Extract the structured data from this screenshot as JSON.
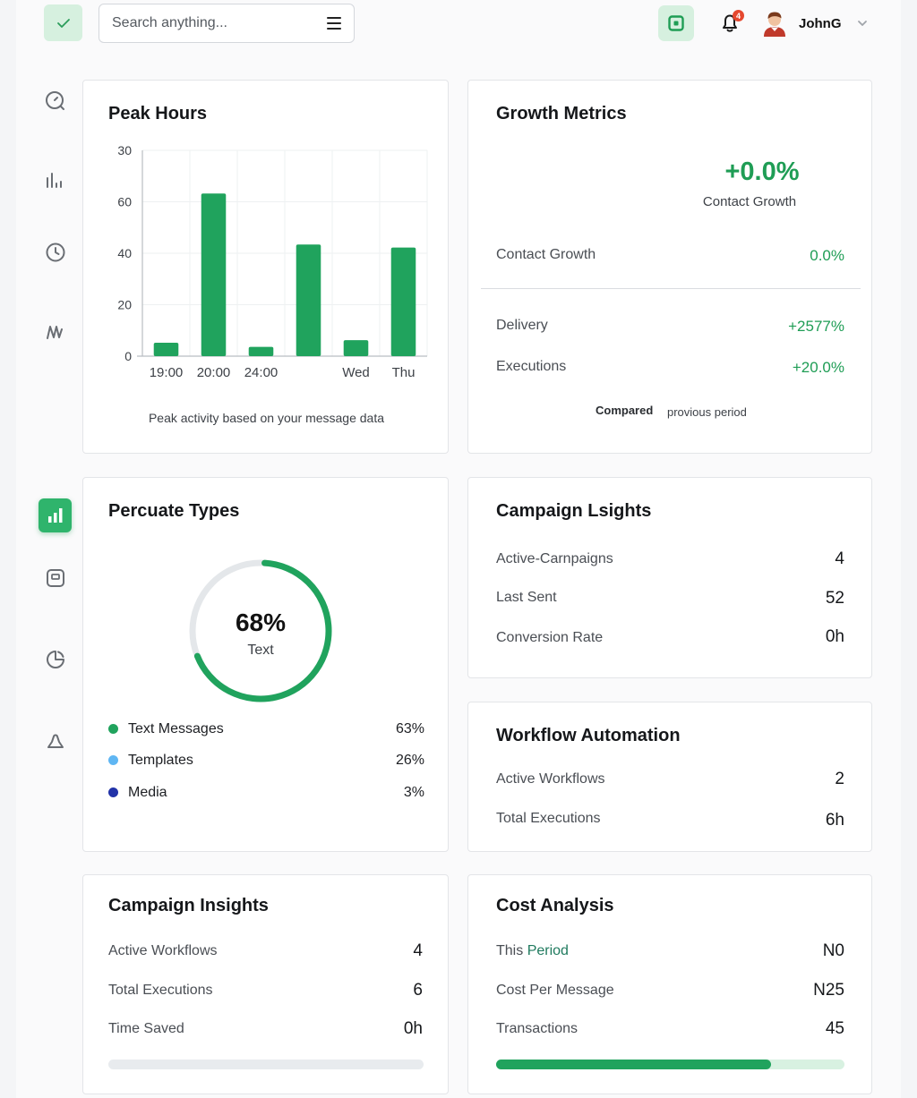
{
  "header": {
    "search_placeholder": "Search anything...",
    "notification_count": "4",
    "username": "JohnG"
  },
  "colors": {
    "accent": "#20a35d",
    "accent_light": "#d6f0df",
    "badge": "#e5482f",
    "templates": "#5fb6f3",
    "media": "#2233a8"
  },
  "peak_hours": {
    "title": "Peak Hours",
    "caption": "Peak activity based on your message data",
    "chart_data": {
      "type": "bar",
      "categories": [
        "19:00",
        "20:00",
        "24:00",
        "",
        "Wed",
        "Thu"
      ],
      "values": [
        2.6,
        31.6,
        1.8,
        21.7,
        3.1,
        21.1
      ],
      "y_ticks": [
        "0",
        "20",
        "40",
        "60",
        "30"
      ],
      "y_tick_values": [
        0,
        10,
        20,
        30,
        40
      ],
      "ylim": [
        0,
        40
      ]
    }
  },
  "growth": {
    "title": "Growth Metrics",
    "big_value": "+0.0%",
    "big_label": "Contact Growth",
    "rows": [
      {
        "label": "Contact Growth",
        "value": "0.0%"
      },
      {
        "label": "Delivery",
        "value": "+2577%"
      },
      {
        "label": "Executions",
        "value": "+20.0%"
      }
    ],
    "footer_bold": "Compared",
    "footer_text": "provious period"
  },
  "types": {
    "title": "Percuate Types",
    "center_value": "68%",
    "center_label": "Text",
    "progress": 0.68,
    "legend": [
      {
        "label": "Text Messages",
        "value": "63%"
      },
      {
        "label": "Templates",
        "value": "26%"
      },
      {
        "label": "Media",
        "value": "3%"
      }
    ]
  },
  "campaign_lsights": {
    "title": "Campaign Lsights",
    "rows": [
      {
        "label": "Active-Carnpaigns",
        "value": "4"
      },
      {
        "label": "Last Sent",
        "value": "52"
      },
      {
        "label": "Conversion Rate",
        "value": "0h"
      }
    ]
  },
  "workflow": {
    "title": "Workflow Automation",
    "rows": [
      {
        "label": "Active Workflows",
        "value": "2"
      },
      {
        "label": "Total Executions",
        "value": "6h"
      }
    ]
  },
  "campaign_insights": {
    "title": "Campaign Insights",
    "rows": [
      {
        "label": "Active Workflows",
        "value": "4"
      },
      {
        "label": "Total Executions",
        "value": "6"
      },
      {
        "label": "Time Saved",
        "value": "0h"
      }
    ],
    "progress": 0
  },
  "cost": {
    "title": "Cost Analysis",
    "rows": [
      {
        "label_a": "This",
        "label_b": "Period",
        "value": "N0"
      },
      {
        "label": "Cost Per Message",
        "value": "N25"
      },
      {
        "label": "Transactions",
        "value": "45"
      }
    ],
    "progress": 0.79
  }
}
